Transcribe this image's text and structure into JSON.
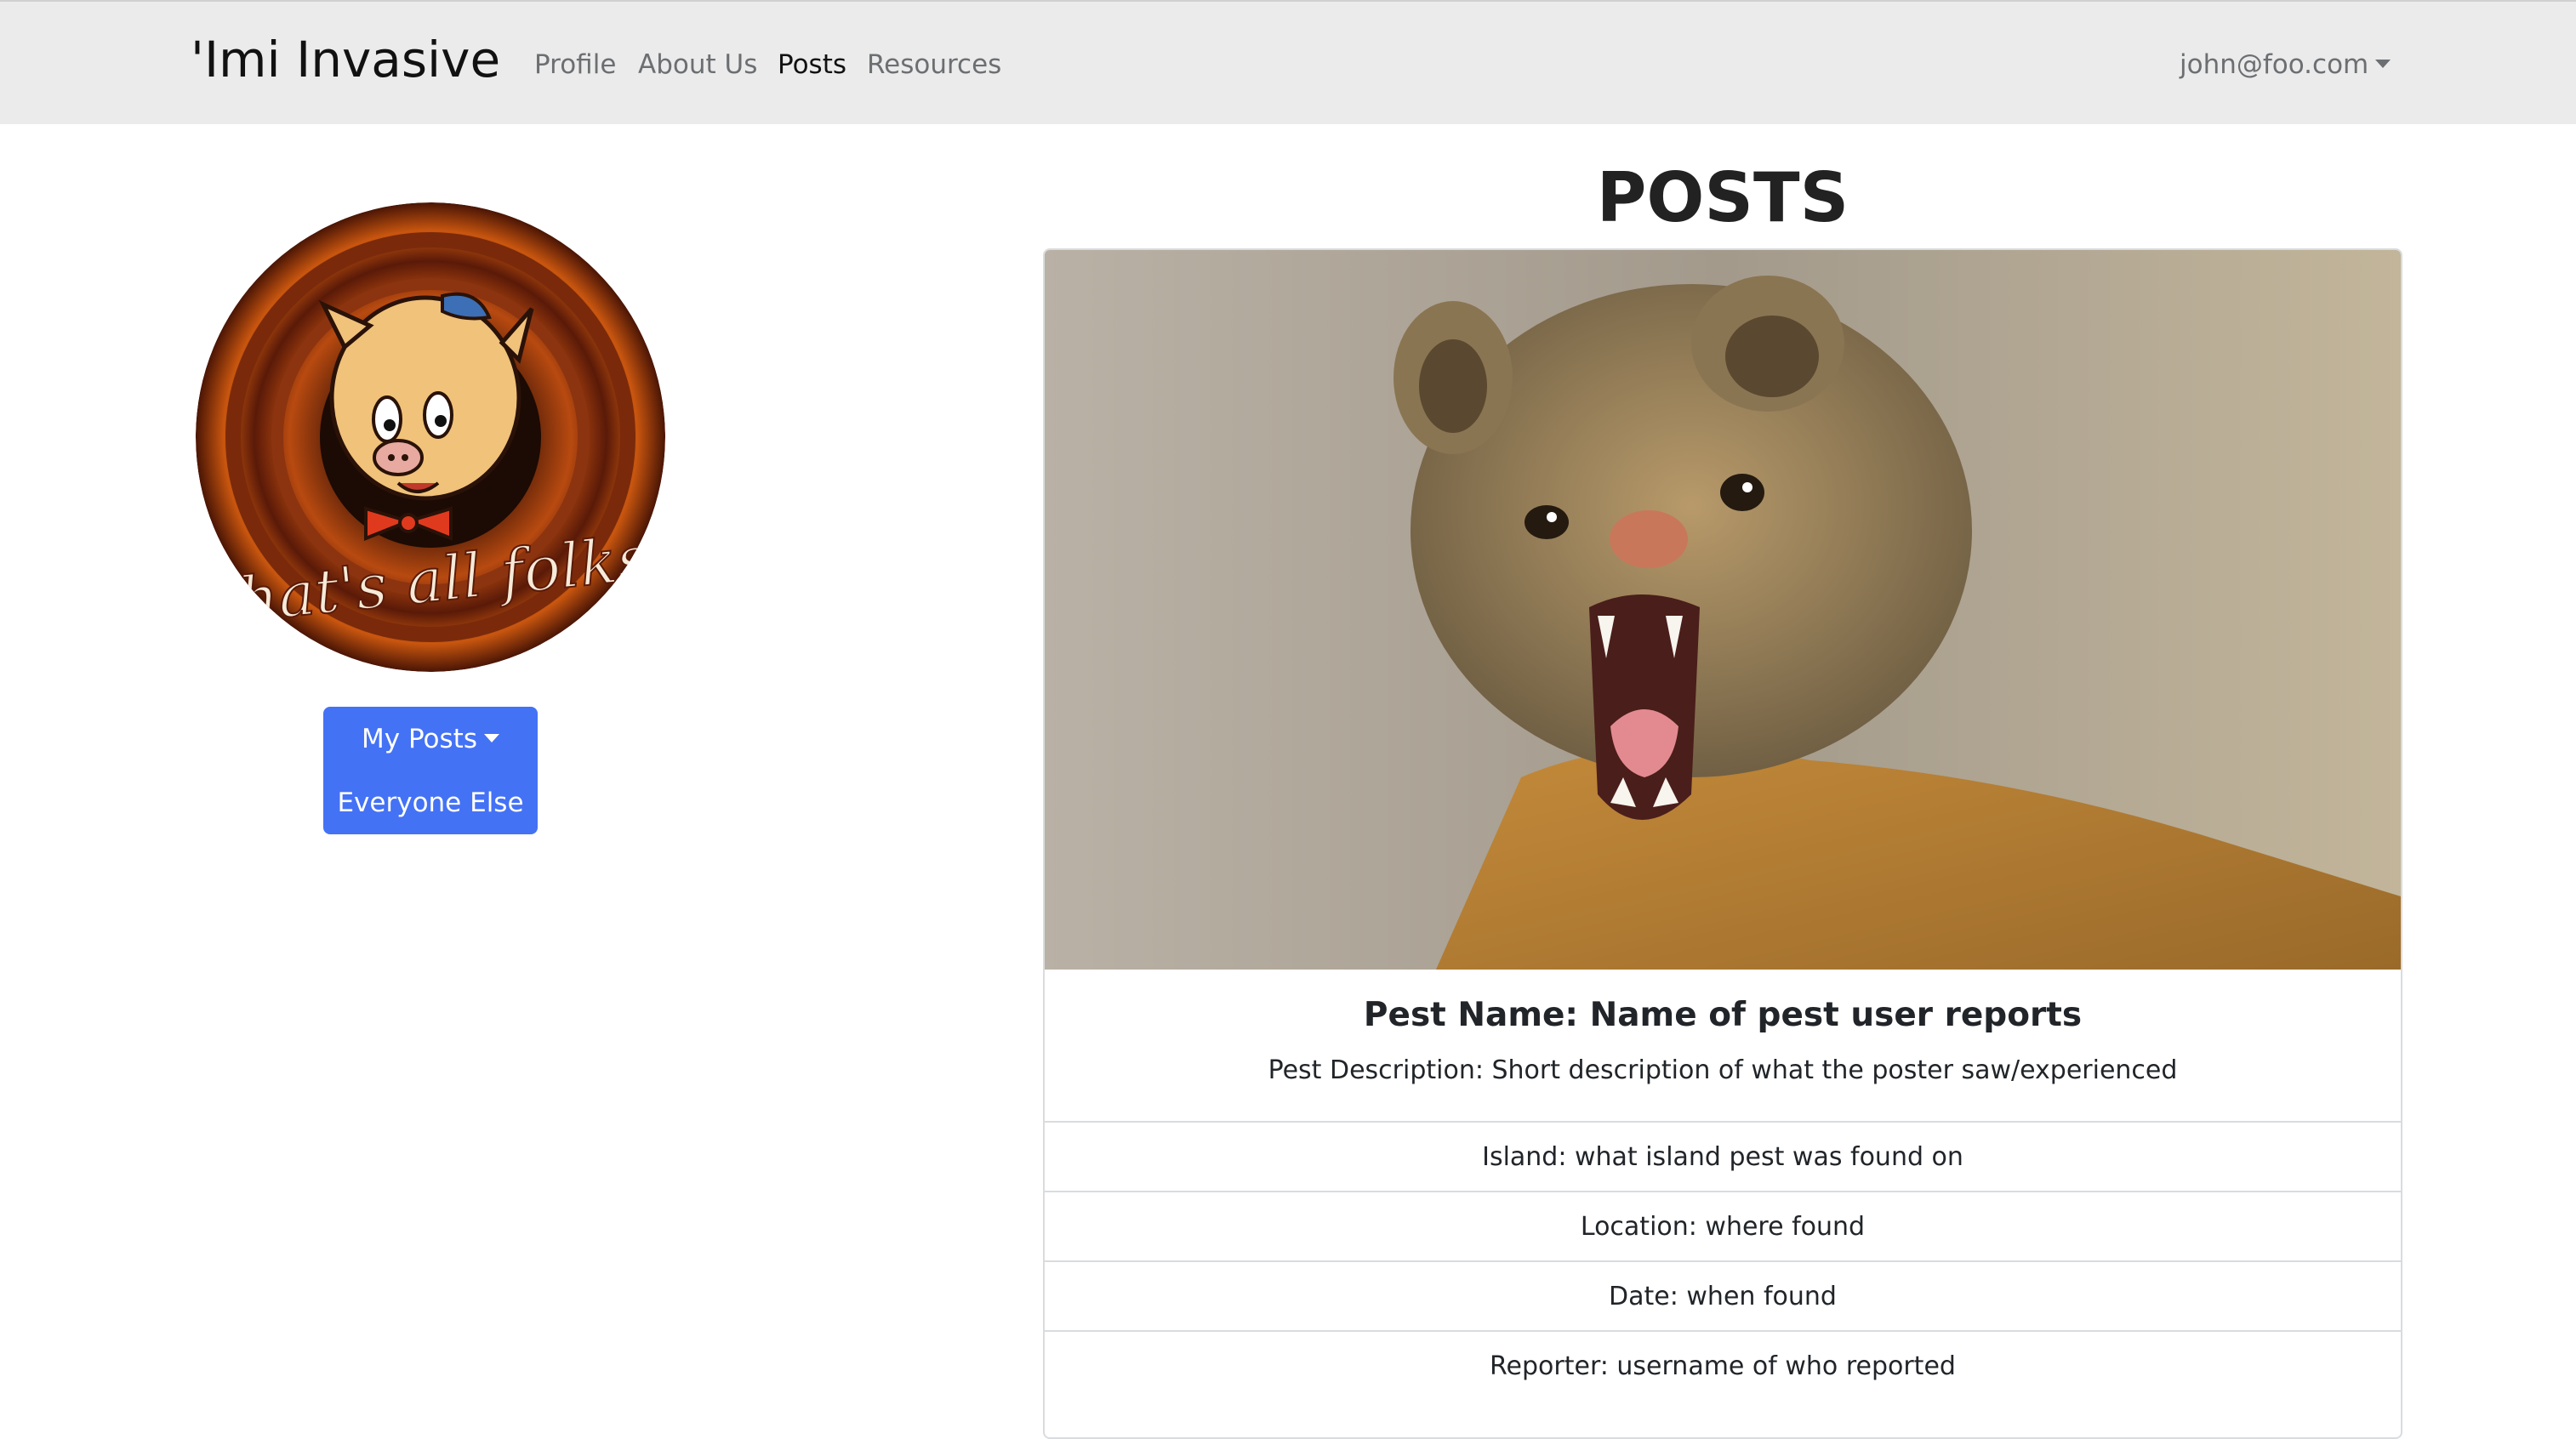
{
  "navbar": {
    "brand": "'Imi Invasive",
    "links": [
      {
        "label": "Profile"
      },
      {
        "label": "About Us"
      },
      {
        "label": "Posts"
      },
      {
        "label": "Resources"
      }
    ],
    "user_email": "john@foo.com"
  },
  "sidebar": {
    "avatar_caption": "That's all folks",
    "my_posts_label": "My Posts",
    "everyone_else_label": "Everyone Else"
  },
  "main": {
    "heading": "POSTS",
    "post": {
      "title": "Pest Name: Name of pest user reports",
      "description": "Pest Description: Short description of what the poster saw/experienced",
      "details": [
        "Island: what island pest was found on",
        "Location: where found",
        "Date: when found",
        "Reporter: username of who reported"
      ]
    }
  },
  "colors": {
    "navbar_bg": "#ebebeb",
    "button_primary": "#4472f5",
    "card_border": "#d9dcdf"
  }
}
